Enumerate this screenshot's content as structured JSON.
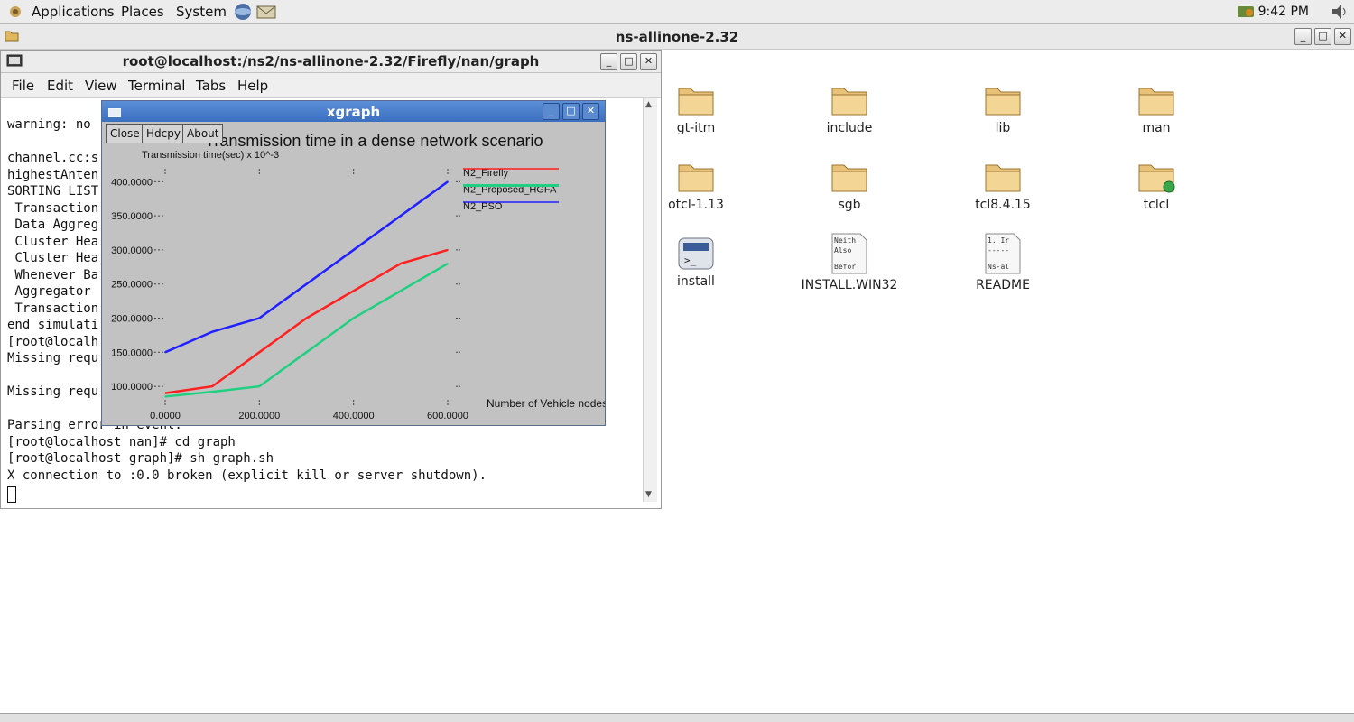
{
  "top_panel": {
    "menus": [
      "Applications",
      "Places",
      "System"
    ],
    "clock": "9:42 PM"
  },
  "file_manager": {
    "title": "ns-allinone-2.32",
    "items": [
      {
        "label": "gt-itm",
        "icon": "folder-icon"
      },
      {
        "label": "include",
        "icon": "folder-icon"
      },
      {
        "label": "lib",
        "icon": "folder-icon"
      },
      {
        "label": "man",
        "icon": "folder-icon"
      },
      {
        "label": "otcl-1.13",
        "icon": "folder-icon"
      },
      {
        "label": "sgb",
        "icon": "folder-icon"
      },
      {
        "label": "tcl8.4.15",
        "icon": "folder-icon"
      },
      {
        "label": "tclcl",
        "icon": "folder-link-icon"
      },
      {
        "label": "install",
        "icon": "script-icon"
      },
      {
        "label": "INSTALL.WIN32",
        "icon": "text-file-icon",
        "preview": [
          "Neith",
          "Also",
          "Befor"
        ]
      },
      {
        "label": "README",
        "icon": "text-file-icon",
        "preview": [
          "1. Ir",
          "-----",
          "Ns-al"
        ]
      }
    ]
  },
  "terminal": {
    "title": "root@localhost:/ns2/ns-allinone-2.32/Firefly/nan/graph",
    "menus": [
      "File",
      "Edit",
      "View",
      "Terminal",
      "Tabs",
      "Help"
    ],
    "lines": [
      "warning: no",
      "",
      "channel.cc:s",
      "highestAnten",
      "SORTING LIST",
      " Transaction",
      " Data Aggreg",
      " Cluster Hea",
      " Cluster Hea",
      " Whenever Ba",
      " Aggregator",
      " Transaction",
      "end simulati",
      "[root@localh",
      "Missing requ",
      "",
      "Missing requ",
      "",
      "Parsing error in event.",
      "[root@localhost nan]# cd graph",
      "[root@localhost graph]# sh graph.sh",
      "X connection to :0.0 broken (explicit kill or server shutdown)."
    ]
  },
  "xgraph": {
    "title": "xgraph",
    "buttons": [
      "Close",
      "Hdcpy",
      "About"
    ]
  },
  "chart_data": {
    "type": "line",
    "title": "Transmission time in a dense network scenario",
    "ylabel": "Transmission time(sec) x 10^-3",
    "xlabel": "Number of Vehicle nodes",
    "x_ticks": [
      "0.0000",
      "200.0000",
      "400.0000",
      "600.0000"
    ],
    "y_ticks": [
      "100.0000",
      "150.0000",
      "200.0000",
      "250.0000",
      "300.0000",
      "350.0000",
      "400.0000"
    ],
    "xlim": [
      0,
      600
    ],
    "ylim": [
      75,
      415
    ],
    "grid": false,
    "legend_position": "top-right",
    "series": [
      {
        "name": "N2_Firefly",
        "color": "#ff2020",
        "x": [
          0,
          100,
          200,
          300,
          400,
          500,
          600
        ],
        "y": [
          90,
          100,
          150,
          200,
          240,
          280,
          300
        ]
      },
      {
        "name": "N2_Proposed_HGFA",
        "color": "#20d080",
        "x": [
          0,
          100,
          200,
          300,
          400,
          500,
          600
        ],
        "y": [
          85,
          92,
          100,
          150,
          200,
          240,
          280
        ]
      },
      {
        "name": "N2_PSO",
        "color": "#2020ff",
        "x": [
          0,
          100,
          200,
          300,
          400,
          500,
          600
        ],
        "y": [
          150,
          180,
          200,
          250,
          300,
          350,
          400
        ]
      }
    ]
  }
}
